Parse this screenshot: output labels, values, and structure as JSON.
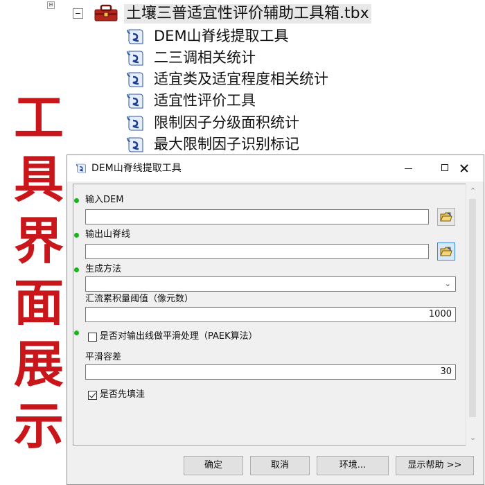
{
  "tree": {
    "top_marker": "⊟",
    "root_label": "土壤三普适宜性评价辅助工具箱.tbx",
    "items": [
      {
        "label": "DEM山脊线提取工具"
      },
      {
        "label": "二三调相关统计"
      },
      {
        "label": "适宜类及适宜程度相关统计"
      },
      {
        "label": "适宜性评价工具"
      },
      {
        "label": "限制因子分级面积统计"
      },
      {
        "label": "最大限制因子识别标记"
      }
    ]
  },
  "caption": [
    "工",
    "具",
    "界",
    "面",
    "展",
    "示"
  ],
  "dialog": {
    "title": "DEM山脊线提取工具",
    "fields": {
      "input_dem": {
        "label": "输入DEM",
        "value": ""
      },
      "output_ridge": {
        "label": "输出山脊线",
        "value": ""
      },
      "method": {
        "label": "生成方法",
        "value": ""
      },
      "threshold": {
        "label": "汇流累积量阈值（像元数）",
        "value": "1000"
      },
      "smooth": {
        "label": "是否对输出线做平滑处理（PAEK算法）",
        "checked": false
      },
      "tolerance": {
        "label": "平滑容差",
        "value": "30"
      },
      "fill": {
        "label": "是否先填洼",
        "checked": true
      }
    },
    "buttons": {
      "ok": "确定",
      "cancel": "取消",
      "env": "环境...",
      "help": "显示帮助 >>"
    }
  },
  "colors": {
    "caption_red": "#c8161b",
    "required_dot": "#14b814"
  }
}
